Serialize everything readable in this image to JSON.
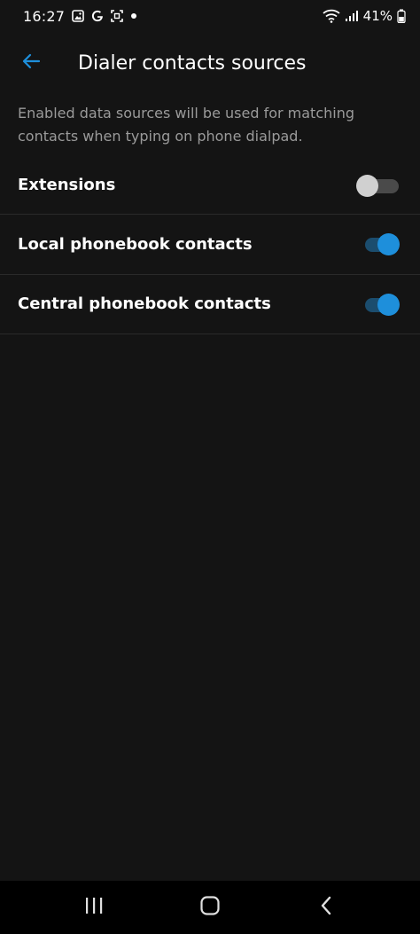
{
  "status_bar": {
    "time": "16:27",
    "battery_percent": "41%",
    "left_icons": [
      "image-icon",
      "google-icon",
      "screenshot-icon",
      "notification-dot-icon"
    ],
    "right_icons": [
      "wifi-icon",
      "signal-icon",
      "battery-icon"
    ]
  },
  "app_bar": {
    "back_icon": "arrow-left-icon",
    "title": "Dialer contacts sources"
  },
  "description": "Enabled data sources will be used for matching contacts when typing on phone dialpad.",
  "settings": [
    {
      "label": "Extensions",
      "enabled": false
    },
    {
      "label": "Local phonebook contacts",
      "enabled": true
    },
    {
      "label": "Central phonebook contacts",
      "enabled": true
    }
  ],
  "colors": {
    "background": "#141414",
    "accent": "#1e8fdb",
    "accent_track": "#1b4d6e",
    "text_secondary": "#9a9a9a",
    "divider": "#2a2a2a"
  },
  "nav_bar": {
    "buttons": [
      "recent-apps-icon",
      "home-icon",
      "back-icon"
    ]
  }
}
